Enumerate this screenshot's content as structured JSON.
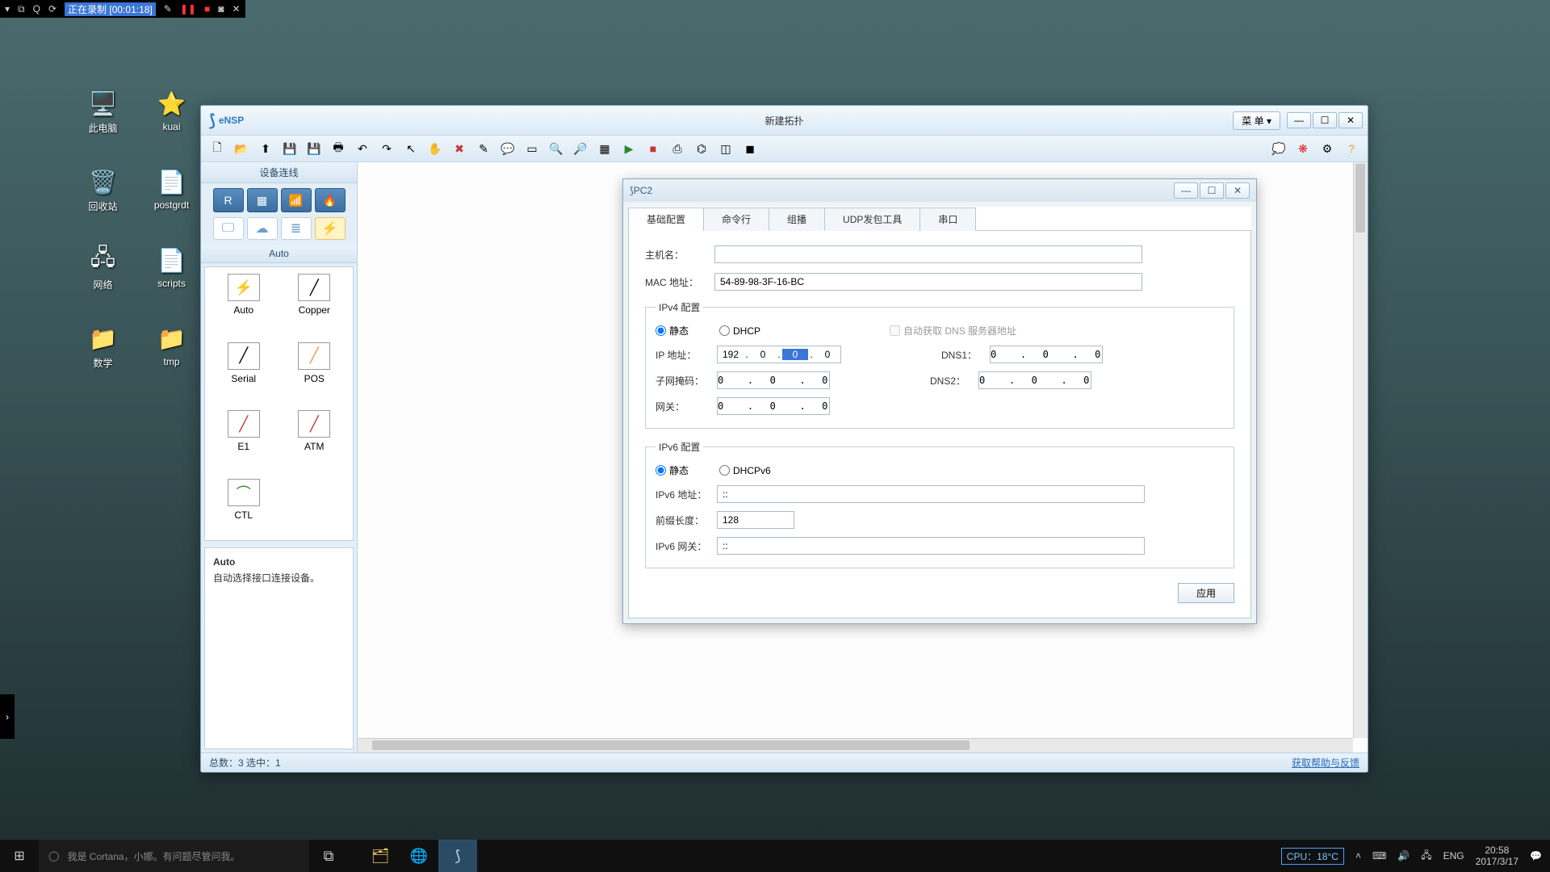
{
  "recbar": {
    "status": "正在录制",
    "time": "[00:01:18]"
  },
  "desktop": [
    {
      "g": "🖥️",
      "l": "此电脑"
    },
    {
      "g": "⭐",
      "l": "kuai"
    },
    {
      "g": "🗑️",
      "l": "回收站"
    },
    {
      "g": "📄",
      "l": "postgrdt"
    },
    {
      "g": "🖧",
      "l": "网络"
    },
    {
      "g": "📄",
      "l": "scripts"
    },
    {
      "g": "📁",
      "l": "数学"
    },
    {
      "g": "📁",
      "l": "tmp"
    }
  ],
  "ensp": {
    "logo": "eNSP",
    "title": "新建拓扑",
    "menu": "菜 单",
    "sidebar": {
      "header": "设备连线",
      "auto_label": "Auto",
      "devices": [
        {
          "l": "Auto",
          "i": "⚡"
        },
        {
          "l": "Copper",
          "i": "╱"
        },
        {
          "l": "Serial",
          "i": "╱"
        },
        {
          "l": "POS",
          "i": "╱"
        },
        {
          "l": "E1",
          "i": "╱"
        },
        {
          "l": "ATM",
          "i": "╱"
        },
        {
          "l": "CTL",
          "i": "⌒"
        }
      ],
      "desc_title": "Auto",
      "desc_body": "自动选择接口连接设备。"
    },
    "status": {
      "left": "总数：3  选中：1",
      "right": "获取帮助与反馈"
    }
  },
  "pc2": {
    "title": "PC2",
    "tabs": [
      "基础配置",
      "命令行",
      "组播",
      "UDP发包工具",
      "串口"
    ],
    "host_label": "主机名：",
    "host_val": "",
    "mac_label": "MAC 地址：",
    "mac_val": "54-89-98-3F-16-BC",
    "v4": {
      "legend": "IPv4 配置",
      "static": "静态",
      "dhcp": "DHCP",
      "autodns": "自动获取 DNS 服务器地址",
      "ip_l": "IP 地址：",
      "ip": [
        "192",
        "0",
        "0",
        "0"
      ],
      "ip_sel_idx": 2,
      "mask_l": "子网掩码：",
      "mask": "0   .  0   .  0   .  0",
      "gw_l": "网关：",
      "gw": "0   .  0   .  0   .  0",
      "dns1_l": "DNS1：",
      "dns1": "0   .  0   .  0   .  0",
      "dns2_l": "DNS2：",
      "dns2": "0   .  0   .  0   .  0"
    },
    "v6": {
      "legend": "IPv6 配置",
      "static": "静态",
      "dhcp": "DHCPv6",
      "ip_l": "IPv6 地址：",
      "ip": "::",
      "plen_l": "前缀长度：",
      "plen": "128",
      "gw_l": "IPv6 网关：",
      "gw": "::"
    },
    "apply": "应用"
  },
  "taskbar": {
    "search": "我是 Cortana，小娜。有问题尽管问我。",
    "cpu": "CPU：18°C",
    "lang": "ENG",
    "time": "20:58",
    "date": "2017/3/17"
  }
}
